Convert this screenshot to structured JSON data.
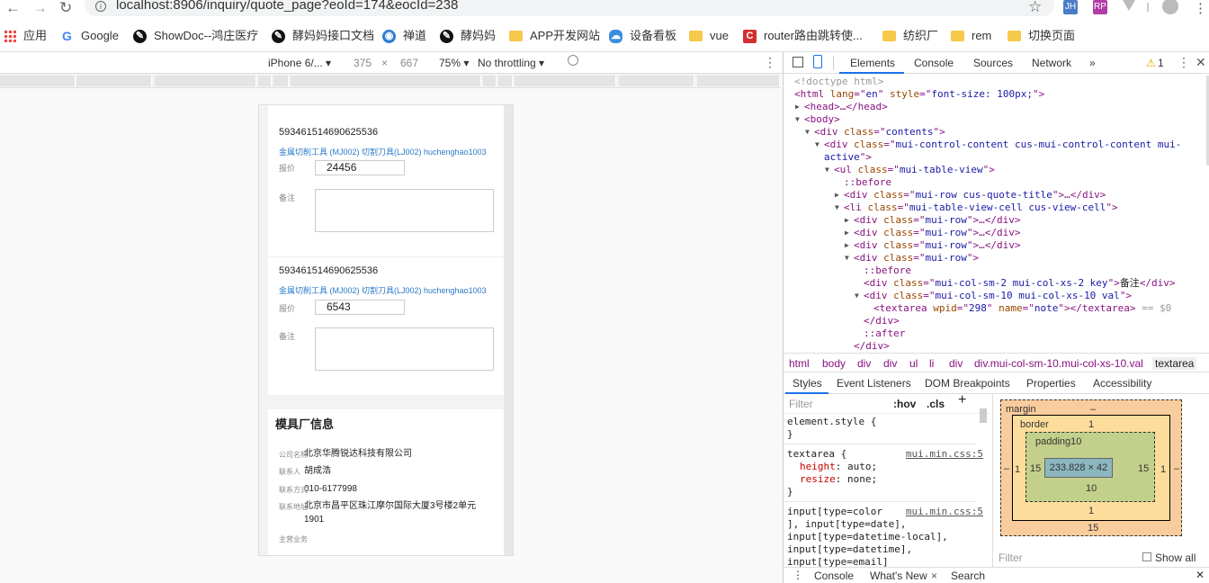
{
  "browser": {
    "url": "localhost:8906/inquiry/quote_page?eoId=174&eocId=238",
    "ext_icons": [
      "JH",
      "RP"
    ],
    "bookmarks": [
      {
        "label": "应用",
        "icon": "apps-grid-icon"
      },
      {
        "label": "Google",
        "icon": "google-icon"
      },
      {
        "label": "ShowDoc--鸿庄医疗",
        "icon": "showdoc-icon"
      },
      {
        "label": "酵妈妈接口文档",
        "icon": "showdoc-icon"
      },
      {
        "label": "禅道",
        "icon": "globe-icon"
      },
      {
        "label": "酵妈妈",
        "icon": "showdoc-icon"
      },
      {
        "label": "APP开发网站",
        "icon": "folder-icon"
      },
      {
        "label": "设备看板",
        "icon": "cloud-icon"
      },
      {
        "label": "vue",
        "icon": "folder-icon"
      },
      {
        "label": "router路由跳转使...",
        "icon": "c-logo-icon"
      },
      {
        "label": "纺织厂",
        "icon": "folder-icon"
      },
      {
        "label": "rem",
        "icon": "folder-icon"
      },
      {
        "label": "切换页面",
        "icon": "folder-icon"
      }
    ]
  },
  "device_toolbar": {
    "device": "iPhone 6/...",
    "width": "375",
    "times": "×",
    "height": "667",
    "zoom": "75%",
    "throttle": "No throttling"
  },
  "quotes": [
    {
      "id": "593461514690625536",
      "title": "金属切削工具 (MJ002) 切割刀具(LJ002) huchenghao1003",
      "price_label": "报价",
      "price": "24456",
      "note_label": "备注"
    },
    {
      "id": "593461514690625536",
      "title": "金属切削工具 (MJ002) 切割刀具(LJ002) huchenghao1003",
      "price_label": "报价",
      "price": "6543",
      "note_label": "备注"
    }
  ],
  "factory": {
    "title": "模具厂信息",
    "rows": [
      {
        "label": "公司名称",
        "value": "北京华腾锐达科技有限公司"
      },
      {
        "label": "联系人",
        "value": "胡成浩"
      },
      {
        "label": "联系方式",
        "value": "010-6177998"
      },
      {
        "label": "联系地址",
        "value": "北京市昌平区珠江摩尔国际大厦3号楼2单元1901"
      },
      {
        "label": "主营业务",
        "value": ""
      }
    ]
  },
  "devtools": {
    "tabs": [
      "Elements",
      "Console",
      "Sources",
      "Network",
      "»"
    ],
    "warn_count": "1",
    "dom_lines": [
      {
        "indent": 0,
        "arrow": "",
        "parts": [
          [
            "cm",
            "<!doctype html>"
          ]
        ]
      },
      {
        "indent": 0,
        "arrow": "",
        "parts": [
          [
            "tg",
            "<html "
          ],
          [
            "at",
            "lang"
          ],
          [
            "tg",
            "=\""
          ],
          [
            "av",
            "en"
          ],
          [
            "tg",
            "\" "
          ],
          [
            "at",
            "style"
          ],
          [
            "tg",
            "=\""
          ],
          [
            "av",
            "font-size: 100px;"
          ],
          [
            "tg",
            "\">"
          ]
        ]
      },
      {
        "indent": 1,
        "arrow": "▶",
        "parts": [
          [
            "tg",
            "<head>…</head>"
          ]
        ]
      },
      {
        "indent": 1,
        "arrow": "▼",
        "parts": [
          [
            "tg",
            "<body>"
          ]
        ]
      },
      {
        "indent": 2,
        "arrow": "▼",
        "parts": [
          [
            "tg",
            "<div "
          ],
          [
            "at",
            "class"
          ],
          [
            "tg",
            "=\""
          ],
          [
            "av",
            "contents"
          ],
          [
            "tg",
            "\">"
          ]
        ]
      },
      {
        "indent": 3,
        "arrow": "▼",
        "parts": [
          [
            "tg",
            "<div "
          ],
          [
            "at",
            "class"
          ],
          [
            "tg",
            "=\""
          ],
          [
            "av",
            "mui-control-content cus-mui-control-content mui-"
          ],
          [
            "tg",
            ""
          ]
        ]
      },
      {
        "indent": 3,
        "arrow": "",
        "parts": [
          [
            "av",
            "active"
          ],
          [
            "tg",
            "\">"
          ]
        ]
      },
      {
        "indent": 4,
        "arrow": "▼",
        "parts": [
          [
            "tg",
            "<ul "
          ],
          [
            "at",
            "class"
          ],
          [
            "tg",
            "=\""
          ],
          [
            "av",
            "mui-table-view"
          ],
          [
            "tg",
            "\">"
          ]
        ]
      },
      {
        "indent": 5,
        "arrow": "",
        "parts": [
          [
            "ps",
            "::before"
          ]
        ]
      },
      {
        "indent": 5,
        "arrow": "▶",
        "parts": [
          [
            "tg",
            "<div "
          ],
          [
            "at",
            "class"
          ],
          [
            "tg",
            "=\""
          ],
          [
            "av",
            "mui-row cus-quote-title"
          ],
          [
            "tg",
            "\">…</div>"
          ]
        ]
      },
      {
        "indent": 5,
        "arrow": "▼",
        "parts": [
          [
            "tg",
            "<li "
          ],
          [
            "at",
            "class"
          ],
          [
            "tg",
            "=\""
          ],
          [
            "av",
            "mui-table-view-cell cus-view-cell"
          ],
          [
            "tg",
            "\">"
          ]
        ]
      },
      {
        "indent": 6,
        "arrow": "▶",
        "parts": [
          [
            "tg",
            "<div "
          ],
          [
            "at",
            "class"
          ],
          [
            "tg",
            "=\""
          ],
          [
            "av",
            "mui-row"
          ],
          [
            "tg",
            "\">…</div>"
          ]
        ]
      },
      {
        "indent": 6,
        "arrow": "▶",
        "parts": [
          [
            "tg",
            "<div "
          ],
          [
            "at",
            "class"
          ],
          [
            "tg",
            "=\""
          ],
          [
            "av",
            "mui-row"
          ],
          [
            "tg",
            "\">…</div>"
          ]
        ]
      },
      {
        "indent": 6,
        "arrow": "▶",
        "parts": [
          [
            "tg",
            "<div "
          ],
          [
            "at",
            "class"
          ],
          [
            "tg",
            "=\""
          ],
          [
            "av",
            "mui-row"
          ],
          [
            "tg",
            "\">…</div>"
          ]
        ]
      },
      {
        "indent": 6,
        "arrow": "▼",
        "parts": [
          [
            "tg",
            "<div "
          ],
          [
            "at",
            "class"
          ],
          [
            "tg",
            "=\""
          ],
          [
            "av",
            "mui-row"
          ],
          [
            "tg",
            "\">"
          ]
        ]
      },
      {
        "indent": 7,
        "arrow": "",
        "parts": [
          [
            "ps",
            "::before"
          ]
        ]
      },
      {
        "indent": 7,
        "arrow": "",
        "parts": [
          [
            "tg",
            "<div "
          ],
          [
            "at",
            "class"
          ],
          [
            "tg",
            "=\""
          ],
          [
            "av",
            "mui-col-sm-2 mui-col-xs-2 key"
          ],
          [
            "tg",
            "\">"
          ],
          [
            "tx",
            "备注"
          ],
          [
            "tg",
            "</div>"
          ]
        ]
      },
      {
        "indent": 7,
        "arrow": "▼",
        "parts": [
          [
            "tg",
            "<div "
          ],
          [
            "at",
            "class"
          ],
          [
            "tg",
            "=\""
          ],
          [
            "av",
            "mui-col-sm-10 mui-col-xs-10 val"
          ],
          [
            "tg",
            "\">"
          ]
        ]
      },
      {
        "indent": 8,
        "arrow": "",
        "selected": true,
        "parts": [
          [
            "tg",
            "<textarea "
          ],
          [
            "at",
            "wpid"
          ],
          [
            "tg",
            "=\""
          ],
          [
            "av",
            "298"
          ],
          [
            "tg",
            "\" "
          ],
          [
            "at",
            "name"
          ],
          [
            "tg",
            "=\""
          ],
          [
            "av",
            "note"
          ],
          [
            "tg",
            "\"></textarea>"
          ],
          [
            "cm",
            " == $0"
          ]
        ]
      },
      {
        "indent": 7,
        "arrow": "",
        "parts": [
          [
            "tg",
            "</div>"
          ]
        ]
      },
      {
        "indent": 7,
        "arrow": "",
        "parts": [
          [
            "ps",
            "::after"
          ]
        ]
      },
      {
        "indent": 6,
        "arrow": "",
        "parts": [
          [
            "tg",
            "</div>"
          ]
        ]
      }
    ],
    "breadcrumbs": [
      "html",
      "body",
      "div",
      "div",
      "ul",
      "li",
      "div",
      "div.mui-col-sm-10.mui-col-xs-10.val",
      "textarea"
    ],
    "style_tabs": [
      "Styles",
      "Event Listeners",
      "DOM Breakpoints",
      "Properties",
      "Accessibility"
    ],
    "filter_placeholder": "Filter",
    "hov": ":hov",
    "cls": ".cls",
    "styles": [
      {
        "selector": "element.style {",
        "source": "",
        "props": [],
        "close": "}"
      },
      {
        "selector": "textarea {",
        "source": "mui.min.css:5",
        "props": [
          [
            "height",
            "auto;"
          ],
          [
            "resize",
            "none;"
          ]
        ],
        "close": "}"
      },
      {
        "selector": "input[type=color",
        "source": "mui.min.css:5",
        "props": [],
        "extra": [
          "], input[type=date],",
          "input[type=datetime-local],",
          "input[type=datetime],",
          "input[type=email]"
        ],
        "close": ""
      }
    ],
    "box": {
      "margin": "margin",
      "margin_val": "–",
      "border": "border",
      "border_val": "1",
      "padding": "padding10",
      "content": "233.828 × 42",
      "pad_side": "15",
      "border_side": "1",
      "margin_side": "–",
      "pad_bottom": "10",
      "border_bottom": "1",
      "margin_bottom": "15"
    },
    "box_filter": "Filter",
    "show_all": "Show all",
    "drawer": [
      "Console",
      "What's New",
      "Search"
    ]
  }
}
